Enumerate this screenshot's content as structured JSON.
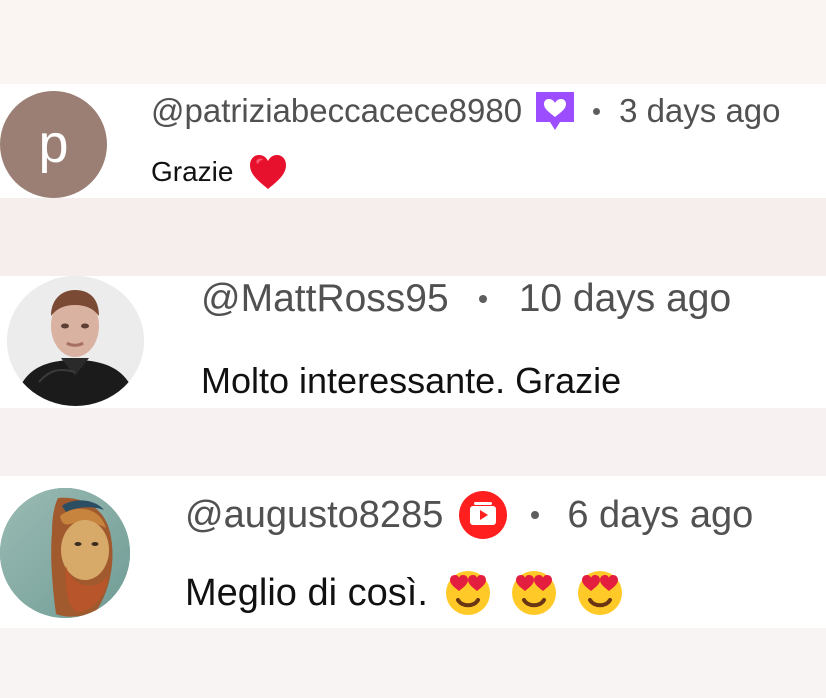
{
  "comments": [
    {
      "avatar_letter": "p",
      "username": "@patriziabeccacece8980",
      "badge_icon": "heart-chat-badge-icon",
      "timestamp": "3 days ago",
      "text": "Grazie",
      "emoji_icons": [
        "red-heart-icon"
      ]
    },
    {
      "username": "@MattRoss95",
      "timestamp": "10 days ago",
      "text": "Molto interessante. Grazie"
    },
    {
      "username": "@augusto8285",
      "badge_icon": "membership-badge-icon",
      "timestamp": "6 days ago",
      "text": "Meglio di così.",
      "emoji_icons": [
        "heart-eyes-emoji-icon",
        "heart-eyes-emoji-icon",
        "heart-eyes-emoji-icon"
      ]
    }
  ],
  "colors": {
    "avatar_letter_bg": "#9b7f74",
    "badge_purple": "#9b4dff",
    "badge_red": "#ff1f1f",
    "heart_red": "#e8112d",
    "meta_text": "#515151"
  }
}
